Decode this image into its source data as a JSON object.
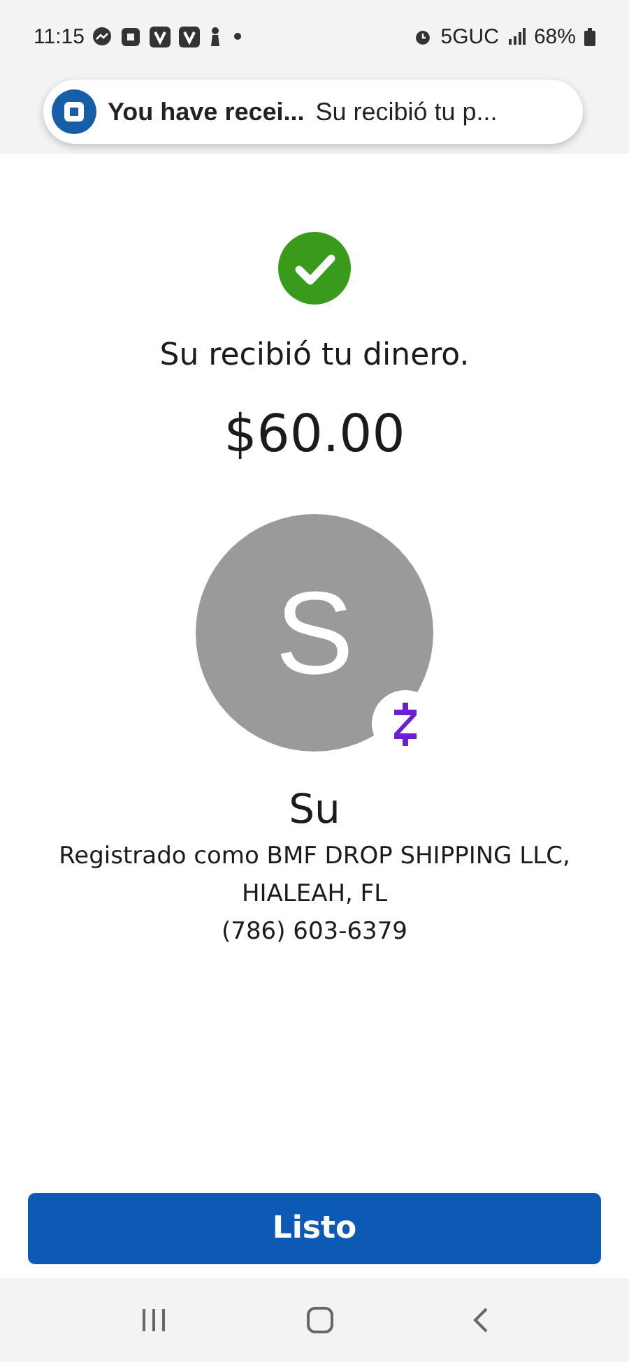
{
  "status_bar": {
    "time": "11:15",
    "network": "5GUC",
    "battery": "68%"
  },
  "notification": {
    "title": "You have recei...",
    "message": "Su recibió tu p..."
  },
  "receipt": {
    "message": "Su recibió tu dinero.",
    "amount": "$60.00",
    "avatar_initial": "S",
    "name": "Su",
    "registered_as": "Registrado como BMF DROP SHIPPING LLC,",
    "location": "HIALEAH, FL",
    "phone": "(786) 603-6379"
  },
  "done_button": {
    "label": "Listo"
  }
}
